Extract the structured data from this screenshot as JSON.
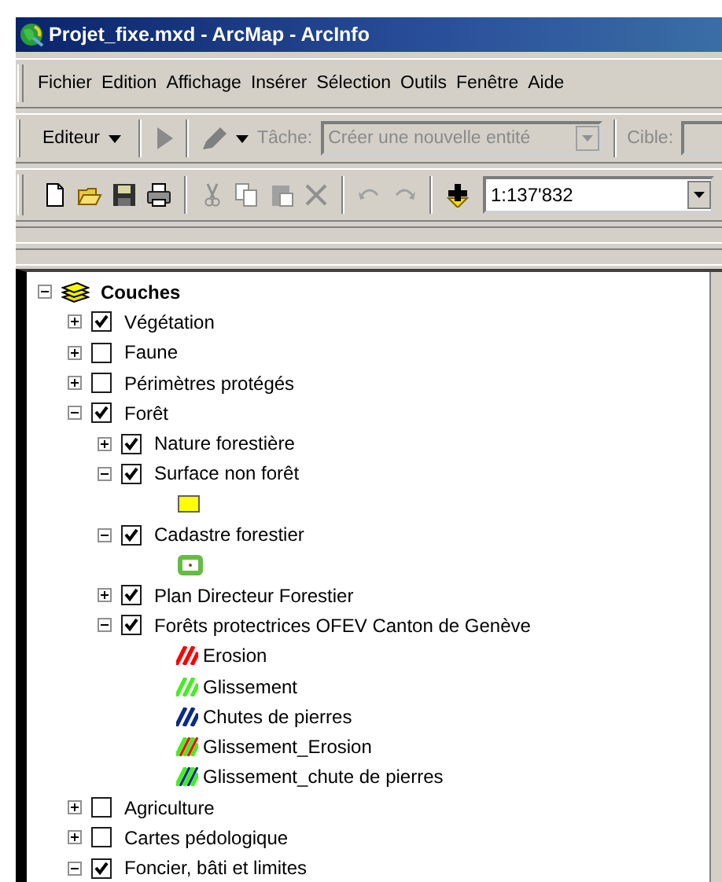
{
  "window": {
    "title": "Projet_fixe.mxd - ArcMap - ArcInfo"
  },
  "menu": [
    "Fichier",
    "Edition",
    "Affichage",
    "Insérer",
    "Sélection",
    "Outils",
    "Fenêtre",
    "Aide"
  ],
  "editor_toolbar": {
    "editor_menu": "Editeur",
    "task_label": "Tâche:",
    "task_value": "Créer une nouvelle entité",
    "task_disabled": true,
    "target_label": "Cible:"
  },
  "standard_toolbar": {
    "scale": "1:137'832"
  },
  "toc": {
    "label": "Couches",
    "expanded": true,
    "children": [
      {
        "kind": "layer",
        "label": "Végétation",
        "checked": true,
        "expanded": false
      },
      {
        "kind": "layer",
        "label": "Faune",
        "checked": false,
        "expanded": false
      },
      {
        "kind": "layer",
        "label": "Périmètres protégés",
        "checked": false,
        "expanded": false
      },
      {
        "kind": "layer",
        "label": "Forêt",
        "checked": true,
        "expanded": true,
        "children": [
          {
            "kind": "layer",
            "label": "Nature forestière",
            "checked": true,
            "expanded": false
          },
          {
            "kind": "layer",
            "label": "Surface non forêt",
            "checked": true,
            "expanded": true,
            "children": [
              {
                "kind": "fill",
                "color": "#ffff00"
              }
            ]
          },
          {
            "kind": "layer",
            "label": "Cadastre forestier",
            "checked": true,
            "expanded": true,
            "children": [
              {
                "kind": "outline",
                "color": "#66bb44"
              }
            ]
          },
          {
            "kind": "layer",
            "label": "Plan Directeur Forestier",
            "checked": true,
            "expanded": false
          },
          {
            "kind": "layer",
            "label": "Forêts protectrices OFEV Canton de Genève",
            "checked": true,
            "expanded": true,
            "children": [
              {
                "kind": "hatch",
                "label": "Erosion",
                "stripes": [
                  {
                    "color": "#ff0000"
                  }
                ]
              },
              {
                "kind": "hatch",
                "label": "Glissement",
                "stripes": [
                  {
                    "color": "#44ee22"
                  }
                ]
              },
              {
                "kind": "hatch",
                "label": "Chutes de pierres",
                "stripes": [
                  {
                    "color": "#0a2a8a"
                  }
                ]
              },
              {
                "kind": "hatch",
                "label": "Glissement_Erosion",
                "stripes": [
                  {
                    "color": "#44ee22"
                  },
                  {
                    "color": "#ff0000"
                  }
                ]
              },
              {
                "kind": "hatch",
                "label": "Glissement_chute de pierres",
                "stripes": [
                  {
                    "color": "#44ee22"
                  },
                  {
                    "color": "#0a2a8a"
                  }
                ]
              }
            ]
          }
        ]
      },
      {
        "kind": "layer",
        "label": "Agriculture",
        "checked": false,
        "expanded": false
      },
      {
        "kind": "layer",
        "label": "Cartes pédologique",
        "checked": false,
        "expanded": false
      },
      {
        "kind": "layer",
        "label": "Foncier, bâti et limites",
        "checked": true,
        "expanded": true
      }
    ]
  }
}
